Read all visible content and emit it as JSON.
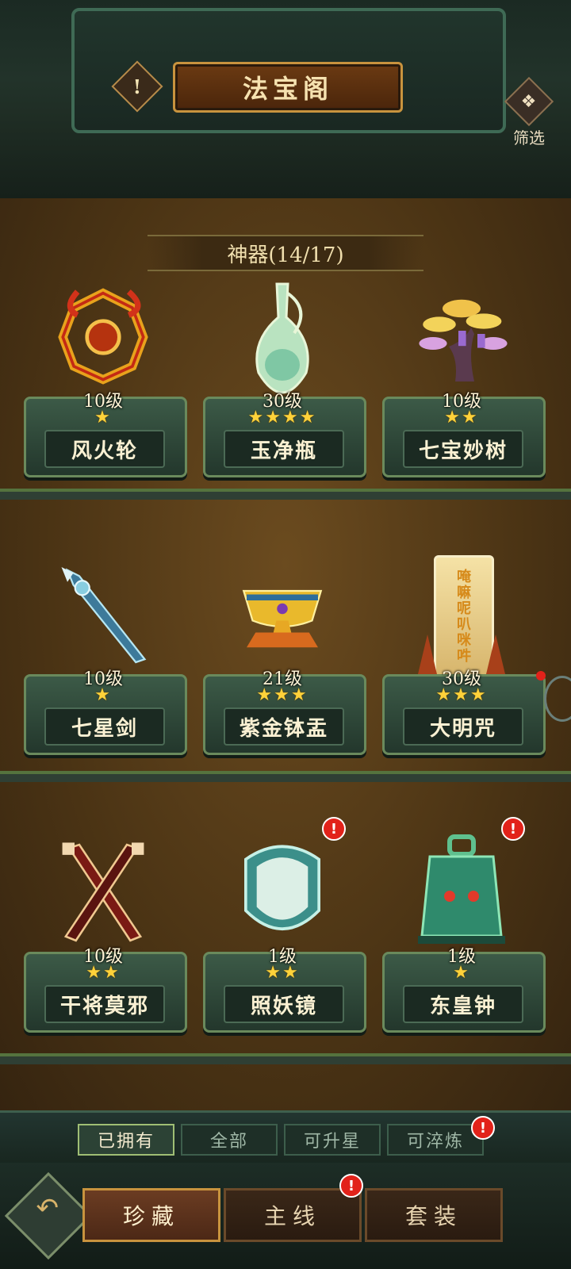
{
  "header": {
    "title": "法宝阁",
    "filter_label": "筛选"
  },
  "category": {
    "label": "神器(14/17)"
  },
  "items": [
    {
      "name": "风火轮",
      "level": "10级",
      "stars": "★",
      "badge": false
    },
    {
      "name": "玉净瓶",
      "level": "30级",
      "stars": "★★★★",
      "badge": false
    },
    {
      "name": "七宝妙树",
      "level": "10级",
      "stars": "★★",
      "badge": false
    },
    {
      "name": "七星剑",
      "level": "10级",
      "stars": "★",
      "badge": false
    },
    {
      "name": "紫金钵盂",
      "level": "21级",
      "stars": "★★★",
      "badge": false
    },
    {
      "name": "大明咒",
      "level": "30级",
      "stars": "★★★",
      "badge": false
    },
    {
      "name": "干将莫邪",
      "level": "10级",
      "stars": "★★",
      "badge": false
    },
    {
      "name": "照妖镜",
      "level": "1级",
      "stars": "★★",
      "badge": true
    },
    {
      "name": "东皇钟",
      "level": "1级",
      "stars": "★",
      "badge": true
    }
  ],
  "mantra_text": [
    "唵",
    "嘛",
    "呢",
    "叭",
    "咪",
    "吽"
  ],
  "filter_tabs": [
    {
      "label": "已拥有",
      "active": true
    },
    {
      "label": "全部",
      "active": false
    },
    {
      "label": "可升星",
      "active": false
    },
    {
      "label": "可淬炼",
      "active": false
    }
  ],
  "nav_tabs": [
    {
      "label": "珍藏",
      "active": true
    },
    {
      "label": "主线",
      "active": false
    },
    {
      "label": "套装",
      "active": false
    }
  ],
  "badge_text": "!",
  "colors": {
    "star": "#ffd23a",
    "badge": "#e2221a",
    "title_plate": "#6b3a12"
  }
}
